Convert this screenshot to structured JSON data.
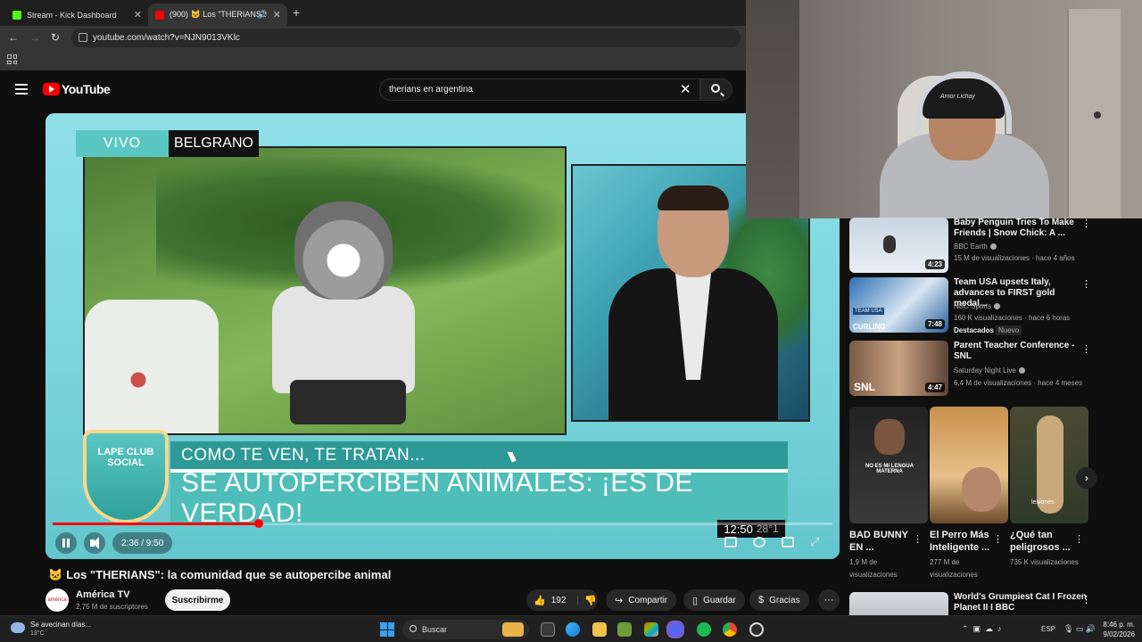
{
  "browser": {
    "tabs": [
      {
        "label": "Stream - Kick Dashboard",
        "favicon_color": "#53fc18"
      },
      {
        "label": "(900) 🐱 Los \"THERIANS\": l",
        "favicon_color": "#ff0000"
      }
    ],
    "url": "youtube.com/watch?v=NJN9013VKlc"
  },
  "youtube": {
    "logo_text": "YouTube",
    "search_query": "therians en argentina"
  },
  "video": {
    "tag_live": "VIVO",
    "tag_location": "BELGRANO",
    "logo_badge": "LAPE CLUB SOCIAL",
    "lower_third_top": "COMO TE VEN, TE TRATAN...",
    "lower_third_bottom": "SE AUTOPERCIBEN ANIMALES: ¡ES DE VERDAD!",
    "overlay_clock": "12:50",
    "overlay_temp": "28°1",
    "time": "2:36 / 9:50",
    "progress_fraction": 0.264
  },
  "details": {
    "title": "Los \"THERIANS\": la comunidad que se autopercibe animal",
    "title_emoji": "🐱",
    "channel_name": "América TV",
    "channel_avatar": "américa",
    "subscribers": "2,75 M de suscriptores",
    "subscribe_label": "Suscribirme",
    "likes": "192",
    "share_label": "Compartir",
    "save_label": "Guardar",
    "thanks_label": "Gracias",
    "more_label": "···"
  },
  "webcam": {
    "cap_text": "Amor Lichay"
  },
  "sidebar": {
    "videos": [
      {
        "title": "Baby Penguin Tries To Make Friends | Snow Chick: A ...",
        "channel": "BBC Earth",
        "meta": "15 M de visualizaciones · hace 4 años",
        "duration": "4:23"
      },
      {
        "title": "Team USA upsets Italy, advances to FIRST gold medal...",
        "channel": "NBC Sports",
        "meta": "160 K visualizaciones · hace 6 horas",
        "duration": "7:48",
        "badge1": "Destacados",
        "badge2": "Nuevo"
      },
      {
        "title": "Parent Teacher Conference - SNL",
        "channel": "Saturday Night Live",
        "meta": "6,4 M de visualizaciones · hace 4 meses",
        "duration": "4:47"
      },
      {
        "title": "World's Grumpiest Cat I Frozen Planet II I BBC",
        "channel": "",
        "meta": "",
        "duration": ""
      }
    ],
    "shorts": [
      {
        "title": "BAD BUNNY EN ...",
        "views": "1,9 M de visualizaciones",
        "thumb_text": "NO ES MI LENGUA MATERNA"
      },
      {
        "title": "El Perro Más Inteligente ...",
        "views": "277 M de visualizaciones",
        "thumb_text": ""
      },
      {
        "title": "¿Qué tan peligrosos ...",
        "views": "735 K visualizaciones",
        "thumb_text": "lesiones"
      }
    ],
    "thumb_labels": {
      "curling": "CURLING",
      "team_usa": "TEAM USA",
      "snl": "SNL"
    }
  },
  "taskbar": {
    "weather_text": "Se avecinan días...",
    "weather_temp": "13°C",
    "search_label": "Buscar",
    "lang": "ESP",
    "time": "8:46 p. m.",
    "date": "9/02/2026"
  }
}
